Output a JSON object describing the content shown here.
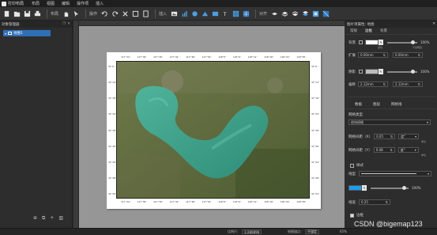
{
  "app": {
    "title": "打印布局"
  },
  "menu": [
    "布局",
    "视图",
    "编辑",
    "操作项",
    "插入"
  ],
  "toolbar": {
    "label_layout": "布局",
    "label_action": "操作",
    "label_insert": "插入",
    "label_align": "对齐"
  },
  "left_panel": {
    "title": "对象管理器",
    "tree_item": "地图1"
  },
  "canvas": {
    "ticks_top": [
      "117°24'",
      "117°30'",
      "117°36'",
      "117°42'",
      "117°48'",
      "117°54'",
      "118°0'",
      "118°6'",
      "118°12'",
      "118°18'",
      "118°24'",
      "118°30'"
    ],
    "ticks_side": [
      "31°6'",
      "31°12'",
      "31°18'",
      "31°24'",
      "31°30'",
      "31°36'",
      "31°42'",
      "31°48'",
      "31°54'"
    ]
  },
  "right_panel": {
    "header": "图片项属性: 地图",
    "tabs": [
      "常规",
      "边框",
      "背景"
    ],
    "bg_label": "背景",
    "bg_color": "#ffffff",
    "bg_opacity": "100%",
    "expand_label": "扩展",
    "expand_x": "0.00mm",
    "expand_y": "0.00mm",
    "shadow_label": "阴影",
    "shadow_color": "#bdbdbd",
    "shadow_opacity": "100%",
    "offset_label": "偏移",
    "offset_x": "2.12mm",
    "offset_y": "2.12mm",
    "sub_tabs": [
      "数据",
      "图层",
      "网格线"
    ],
    "grid_type_label": "网格类型",
    "grid_type_value": "经纬网格",
    "grid_x_label": "网格间距（X）",
    "grid_x_value": "0.05",
    "grid_x_unit": "度°",
    "grid_y_label": "网格间距（Y）",
    "grid_y_value": "0.08",
    "grid_y_unit": "度°",
    "style_label": "样式",
    "line_label": "线型",
    "line_color": "#1e9bf0",
    "line_opacity": "100%",
    "width_label": "线宽",
    "width_value": "0.25",
    "border_label": "边框",
    "mini_units": "单位",
    "mini_opacity": "不透明度",
    "mini_color": "颜色"
  },
  "status": {
    "scale_label": "比例尺：",
    "scale_value": "1:280896",
    "anchor_label": "地图锚点：",
    "anchor_value": "不锚定",
    "zoom": "65%"
  },
  "watermark": "CSDN @bigemap123",
  "colors": {
    "accent": "#2f6fb7",
    "lake": "#3aa38a"
  }
}
